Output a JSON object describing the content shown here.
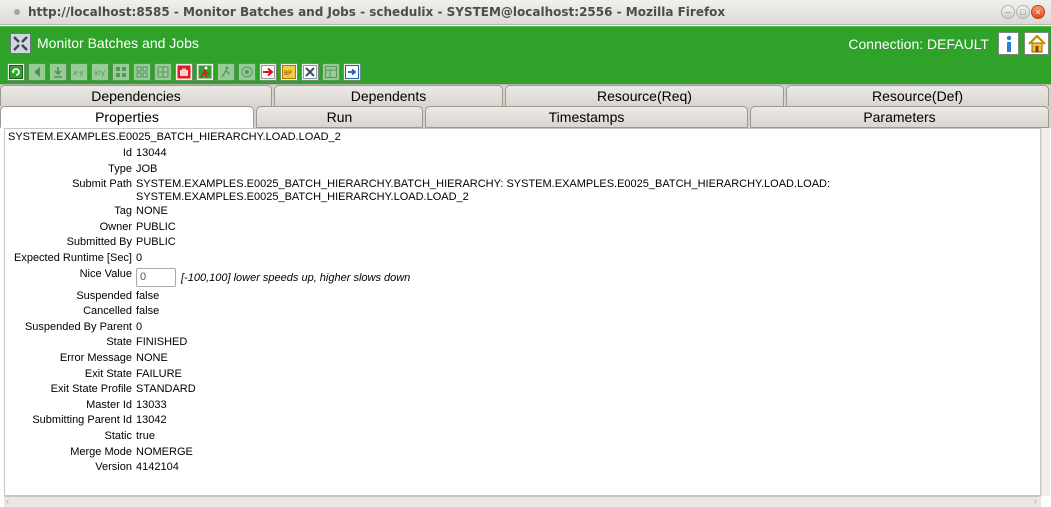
{
  "window": {
    "title": "http://localhost:8585 - Monitor Batches and Jobs - schedulix - SYSTEM@localhost:2556 - Mozilla Firefox"
  },
  "app": {
    "title": "Monitor Batches and Jobs",
    "connection": "Connection: DEFAULT",
    "info_icon": "info-icon",
    "home_icon": "home-icon",
    "brand_color": "#2fa22a"
  },
  "tabs": {
    "row1": [
      "Dependencies",
      "Dependents",
      "Resource(Req)",
      "Resource(Def)"
    ],
    "row2": [
      "Properties",
      "Run",
      "Timestamps",
      "Parameters"
    ],
    "active": "Properties"
  },
  "content": {
    "path": "SYSTEM.EXAMPLES.E0025_BATCH_HIERARCHY.LOAD.LOAD_2",
    "properties": [
      {
        "label": "Id",
        "value": "13044"
      },
      {
        "label": "Type",
        "value": "JOB"
      },
      {
        "label": "Submit Path",
        "value": "SYSTEM.EXAMPLES.E0025_BATCH_HIERARCHY.BATCH_HIERARCHY: SYSTEM.EXAMPLES.E0025_BATCH_HIERARCHY.LOAD.LOAD:",
        "value2": "SYSTEM.EXAMPLES.E0025_BATCH_HIERARCHY.LOAD.LOAD_2"
      },
      {
        "label": "Tag",
        "value": "NONE"
      },
      {
        "label": "Owner",
        "value": "PUBLIC"
      },
      {
        "label": "Submitted By",
        "value": "PUBLIC"
      },
      {
        "label": "Expected Runtime [Sec]",
        "value": "0"
      },
      {
        "label": "Nice Value",
        "value": "0",
        "hint": "[-100,100] lower speeds up, higher slows down"
      },
      {
        "label": "Suspended",
        "value": "false"
      },
      {
        "label": "Cancelled",
        "value": "false"
      },
      {
        "label": "Suspended By Parent",
        "value": "0"
      },
      {
        "label": "State",
        "value": "FINISHED"
      },
      {
        "label": "Error Message",
        "value": "NONE"
      },
      {
        "label": "Exit State",
        "value": "FAILURE"
      },
      {
        "label": "Exit State Profile",
        "value": "STANDARD"
      },
      {
        "label": "Master Id",
        "value": "13033"
      },
      {
        "label": "Submitting Parent Id",
        "value": "13042"
      },
      {
        "label": "Static",
        "value": "true"
      },
      {
        "label": "Merge Mode",
        "value": "NOMERGE"
      },
      {
        "label": "Version",
        "value": "4142104"
      }
    ]
  }
}
